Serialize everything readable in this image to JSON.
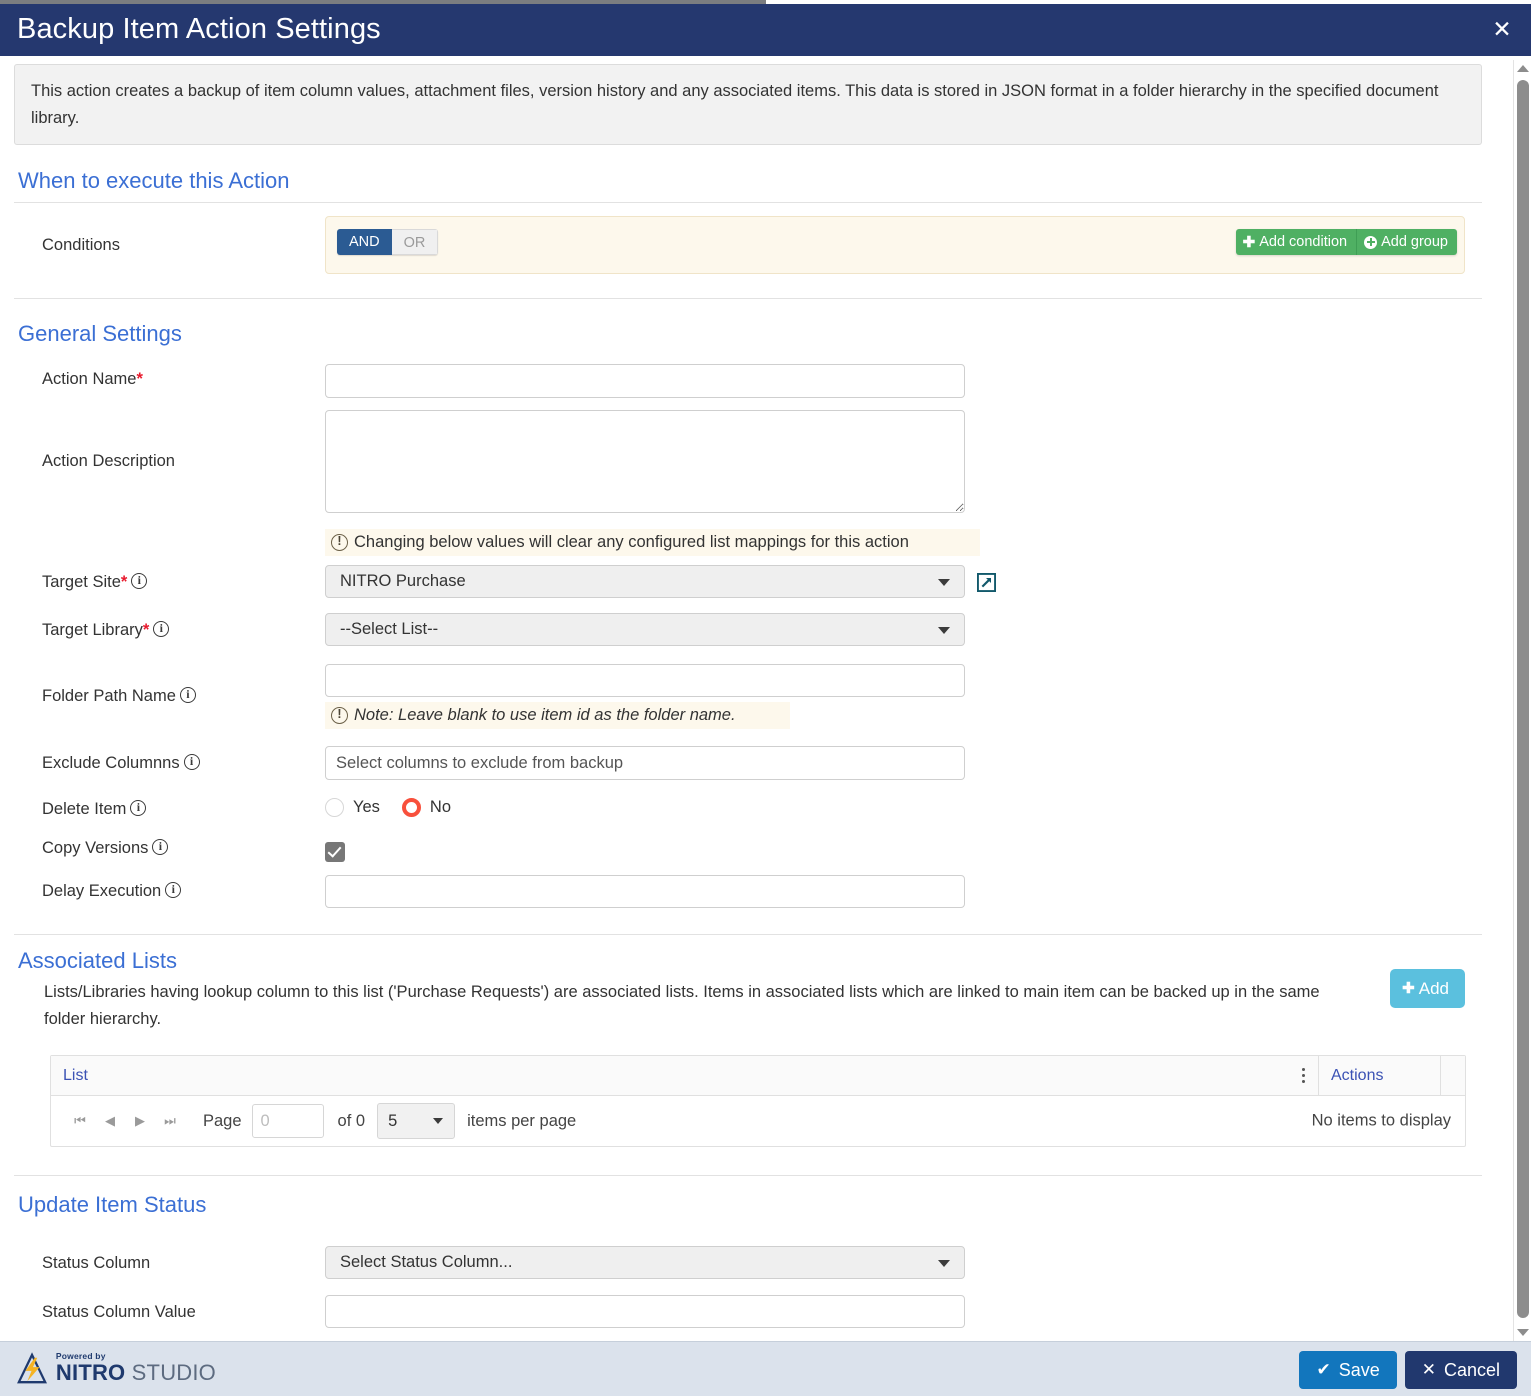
{
  "dialog": {
    "title": "Backup Item Action Settings",
    "close_label": "✕",
    "description": "This action creates a backup of item column values, attachment files, version history and any associated items. This data is stored in JSON format in a folder hierarchy in the specified document library."
  },
  "when_section": {
    "heading": "When to execute this Action",
    "conditions_label": "Conditions",
    "logic_and": "AND",
    "logic_or": "OR",
    "add_condition": "Add condition",
    "add_group": "Add group"
  },
  "general_settings": {
    "heading": "General Settings",
    "action_name_label": "Action Name",
    "action_name_value": "",
    "action_name_placeholder": "",
    "action_description_label": "Action Description",
    "action_description_value": "",
    "change_warning": "Changing below values will clear any configured list mappings for this action",
    "target_site_label": "Target Site",
    "target_site_value": "NITRO Purchase",
    "target_library_label": "Target Library",
    "target_library_value": "--Select List--",
    "folder_path_label": "Folder Path Name",
    "folder_path_value": "",
    "folder_path_note": "Note: Leave blank to use item id as the folder name.",
    "exclude_columns_label": "Exclude Columnns",
    "exclude_columns_placeholder": "Select columns to exclude from backup",
    "exclude_columns_value": "",
    "delete_item_label": "Delete Item",
    "delete_item_yes": "Yes",
    "delete_item_no": "No",
    "delete_item_selected": "No",
    "copy_versions_label": "Copy Versions",
    "copy_versions_checked": true,
    "delay_execution_label": "Delay Execution",
    "delay_execution_value": "",
    "required_marker": "*"
  },
  "associated_lists": {
    "heading": "Associated Lists",
    "description": "Lists/Libraries having lookup column to this list ('Purchase Requests') are associated lists. Items in associated lists which are linked to main item can be backed up in the same folder hierarchy.",
    "add_button": "Add",
    "columns": [
      "List",
      "Actions"
    ],
    "rows": [],
    "pager": {
      "page_label": "Page",
      "page_value": "",
      "page_placeholder": "0",
      "of_label": "of 0",
      "page_size": "5",
      "items_per_page_label": "items per page",
      "empty_message": "No items to display"
    }
  },
  "update_item_status": {
    "heading": "Update Item Status",
    "status_column_label": "Status Column",
    "status_column_value": "Select Status Column...",
    "status_column_value_label": "Status Column Value",
    "status_column_value_input": ""
  },
  "footer": {
    "logo_powered": "Powered by",
    "logo_nitro": "NITRO",
    "logo_studio": " STUDIO",
    "save_label": "Save",
    "cancel_label": "Cancel"
  },
  "colors": {
    "titlebar": "#25386f",
    "accent_heading": "#3b6fd4",
    "green_button": "#4fb063",
    "add_button": "#5bc0de",
    "save_button": "#1276bd",
    "cancel_button": "#21386e",
    "required_star": "#e8192c",
    "radio_selected": "#f8503c"
  }
}
